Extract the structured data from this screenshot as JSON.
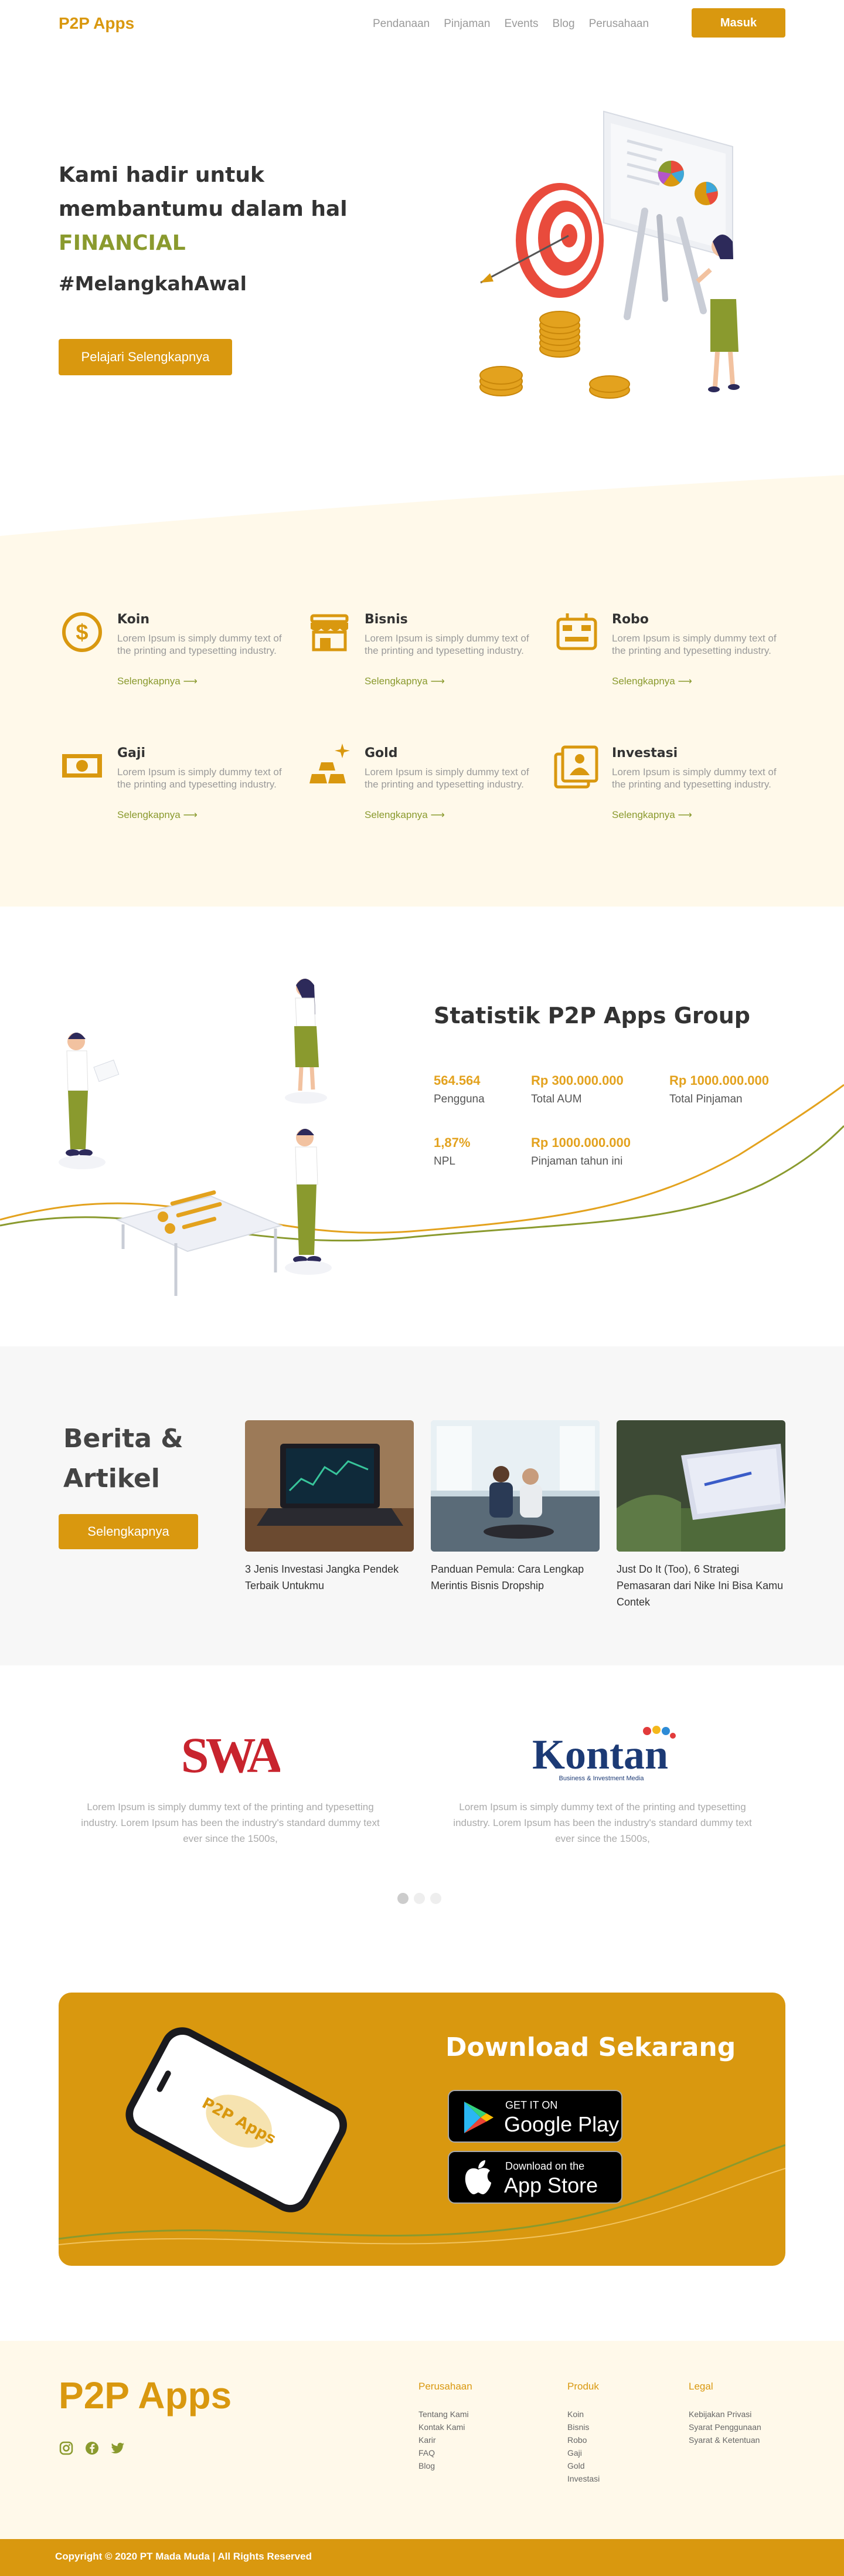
{
  "nav": {
    "logo": "P2P Apps",
    "links": [
      "Pendanaan",
      "Pinjaman",
      "Events",
      "Blog",
      "Perusahaan"
    ],
    "login_label": "Masuk"
  },
  "hero": {
    "line1": "Kami hadir untuk",
    "line2": "membantumu dalam hal",
    "highlight": "FINANCIAL",
    "hashtag": "#MelangkahAwal",
    "cta_label": "Pelajari Selengkapnya"
  },
  "features": [
    {
      "title": "Koin",
      "desc": "Lorem Ipsum is simply dummy text of the printing and typesetting industry.",
      "link": "Selengkapnya ⟶",
      "icon": "coin-icon"
    },
    {
      "title": "Bisnis",
      "desc": "Lorem Ipsum is simply dummy text of the printing and typesetting industry.",
      "link": "Selengkapnya ⟶",
      "icon": "store-icon"
    },
    {
      "title": "Robo",
      "desc": "Lorem Ipsum is simply dummy text of the printing and typesetting industry.",
      "link": "Selengkapnya ⟶",
      "icon": "robot-icon"
    },
    {
      "title": "Gaji",
      "desc": "Lorem Ipsum is simply dummy text of the printing and typesetting industry.",
      "link": "Selengkapnya ⟶",
      "icon": "money-icon"
    },
    {
      "title": "Gold",
      "desc": "Lorem Ipsum is simply dummy text of the printing and typesetting industry.",
      "link": "Selengkapnya ⟶",
      "icon": "gold-bars-icon"
    },
    {
      "title": "Investasi",
      "desc": "Lorem Ipsum is simply dummy text of the printing and typesetting industry.",
      "link": "Selengkapnya ⟶",
      "icon": "portfolio-icon"
    }
  ],
  "stats": {
    "title": "Statistik P2P Apps Group",
    "items": [
      {
        "value": "564.564",
        "label": "Pengguna"
      },
      {
        "value": "Rp 300.000.000",
        "label": "Total AUM"
      },
      {
        "value": "Rp 1000.000.000",
        "label": "Total Pinjaman"
      },
      {
        "value": "1,87%",
        "label": "NPL"
      },
      {
        "value": "Rp 1000.000.000",
        "label": "Pinjaman tahun ini"
      }
    ]
  },
  "berita": {
    "title_line1": "Berita &",
    "title_line2": "Artikel",
    "cta_label": "Selengkapnya",
    "articles": [
      {
        "title": "3 Jenis Investasi Jangka Pendek Terbaik Untukmu"
      },
      {
        "title": "Panduan Pemula: Cara Lengkap Merintis Bisnis Dropship"
      },
      {
        "title": "Just Do It (Too), 6 Strategi Pemasaran dari Nike Ini Bisa Kamu Contek"
      }
    ]
  },
  "testimonials": [
    {
      "brand": "SWA",
      "text": "Lorem Ipsum is simply dummy text of the printing and typesetting industry. Lorem Ipsum has been the industry's standard dummy text ever since the 1500s,"
    },
    {
      "brand": "Kontan",
      "tagline": "Business & Investment Media",
      "text": "Lorem Ipsum is simply dummy text of the printing and typesetting industry. Lorem Ipsum has been the industry's standard dummy text ever since the 1500s,"
    }
  ],
  "download": {
    "title": "Download Sekarang",
    "phone_brand": "P2P Apps",
    "google_small": "GET IT ON",
    "google_big": "Google Play",
    "apple_small": "Download on the",
    "apple_big": "App Store"
  },
  "footer": {
    "logo": "P2P Apps",
    "social": [
      "instagram-icon",
      "facebook-icon",
      "twitter-icon"
    ],
    "columns": [
      {
        "title": "Perusahaan",
        "links": [
          "Tentang Kami",
          "Kontak Kami",
          "Karir",
          "FAQ",
          "Blog"
        ]
      },
      {
        "title": "Produk",
        "links": [
          "Koin",
          "Bisnis",
          "Robo",
          "Gaji",
          "Gold",
          "Investasi"
        ]
      },
      {
        "title": "Legal",
        "links": [
          "Kebijakan Privasi",
          "Syarat Penggunaan",
          "Syarat & Ketentuan"
        ]
      }
    ],
    "copyright": "Copyright © 2020 PT Mada Muda  |   All Rights Reserved"
  },
  "colors": {
    "primary": "#D9980F",
    "accent_green": "#8A9A2E",
    "cream": "#FFF9EA",
    "light_gray": "#F7F7F7"
  }
}
